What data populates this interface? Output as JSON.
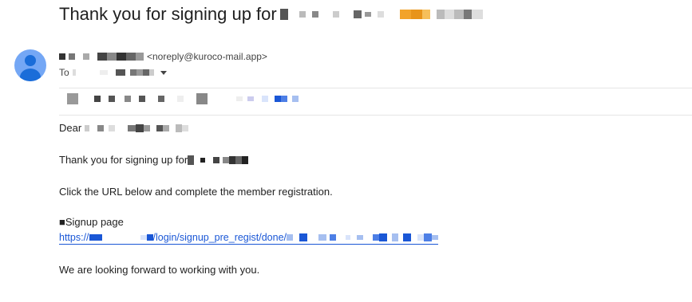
{
  "email": {
    "subject": "Thank you for signing up for",
    "from_email": "<noreply@kuroco-mail.app>",
    "to_label": "To",
    "greeting": "Dear",
    "line1": "Thank you for signing up for",
    "line2": "Click the URL below and complete the member registration.",
    "signup_heading": "■Signup page",
    "link_prefix": "https://",
    "link_path": "/login/signup_pre_regist/done/",
    "closing": "We are looking forward to working with you."
  },
  "colors": {
    "avatar_bg": "#74a7f5",
    "avatar_fg": "#1a6dd9",
    "link": "#1a57d6",
    "redaction_gray": "#6b6b6b",
    "redaction_highlight": "#f2a32a"
  },
  "icons": {
    "avatar": "person-avatar-icon",
    "recipients_caret": "caret-down-icon"
  }
}
